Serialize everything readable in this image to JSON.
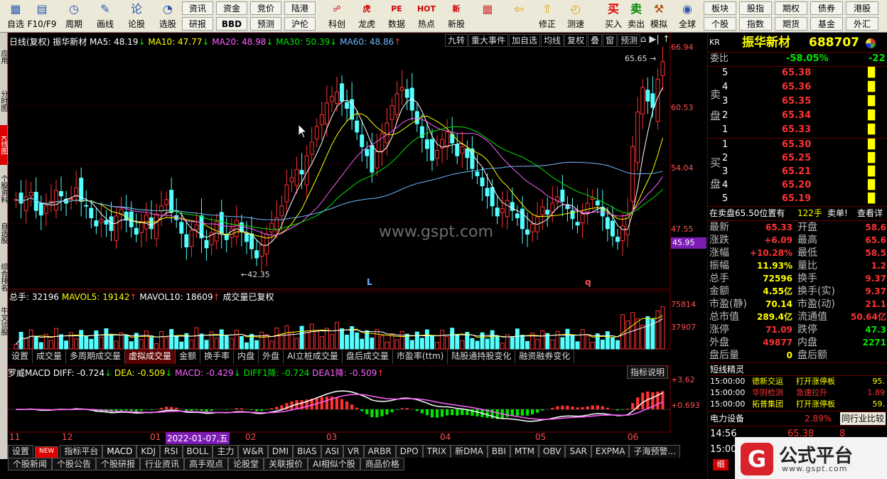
{
  "toolbar": {
    "items": [
      {
        "label": "自选",
        "icon": "▦"
      },
      {
        "label": "F10/F9",
        "icon": "▤"
      },
      {
        "label": "周期",
        "icon": "◷"
      },
      {
        "label": "画线",
        "icon": "✎"
      },
      {
        "label": "论股",
        "icon": "论"
      },
      {
        "label": "选股",
        "icon": "◔"
      }
    ],
    "boxes_top": [
      "资讯",
      "资金",
      "竞价",
      "陆港"
    ],
    "boxes_bottom": [
      "研报",
      "BBD",
      "预测",
      "沪伦"
    ],
    "items2": [
      {
        "label": "科创",
        "icon": "☍"
      },
      {
        "label": "龙虎",
        "icon": "虎"
      },
      {
        "label": "数据",
        "icon": "PE"
      },
      {
        "label": "热点",
        "icon": "HOT"
      },
      {
        "label": "新股",
        "icon": "新"
      }
    ],
    "items3": [
      {
        "label": "",
        "icon": "▦"
      },
      {
        "label": "",
        "icon": "⇦"
      },
      {
        "label": "修正",
        "icon": "⇧"
      },
      {
        "label": "测速",
        "icon": "◴"
      }
    ],
    "trade": [
      {
        "label": "买入",
        "icon": "买"
      },
      {
        "label": "卖出",
        "icon": "卖"
      },
      {
        "label": "模拟",
        "icon": "⚒"
      }
    ],
    "globe": {
      "label": "全球",
      "icon": "◉"
    },
    "right_top": [
      "板块",
      "股指",
      "期权",
      "债券",
      "全球"
    ],
    "right_top_txt": [
      "板块",
      "股指",
      "期权",
      "债券",
      "港股"
    ],
    "right_bottom": [
      "个股",
      "指数",
      "期货",
      "基金",
      "外汇"
    ]
  },
  "left_strip": [
    "应用",
    "分时图",
    "K线图",
    "个股资料",
    "自选股",
    "综合排名",
    "牛叉诊股"
  ],
  "chart_header": {
    "title": "日线(复权)",
    "name": "振华新材",
    "ma5": "MA5: 48.19",
    "ma10": "MA10: 47.77",
    "ma20": "MA20: 48.98",
    "ma30": "MA30: 50.39",
    "ma60": "MA60: 48.86",
    "buttons": [
      "九转",
      "重大事件",
      "加自选",
      "均线",
      "复权",
      "叠",
      "窗",
      "预测"
    ]
  },
  "price_axis": {
    "labels": [
      "66.94",
      "60.53",
      "54.04",
      "47.55"
    ],
    "current": "45.95"
  },
  "annotations": {
    "high": "65.65",
    "low": "42.35",
    "mark_l": "L",
    "mark_q": "q",
    "watermark": "www.gspt.com"
  },
  "volume_header": {
    "total": "总手: 32196",
    "mavol5": "MAVOL5: 19142",
    "mavol10": "MAVOL10: 18609",
    "note": "成交量已复权"
  },
  "volume_axis": [
    "75814",
    "37907"
  ],
  "volume_tabs": [
    "设置",
    "成交量",
    "多周期成交量",
    "虚拟成交量",
    "金额",
    "换手率",
    "内盘",
    "外盘",
    "AI立桩成交量",
    "盘后成交量",
    "市盈率(ttm)",
    "陆股通持股变化",
    "融资融券变化"
  ],
  "macd_header": {
    "name": "罗威MACD",
    "diff": "DIFF: -0.724",
    "dea": "DEA: -0.509",
    "macd": "MACD: -0.429",
    "diff1": "DIFF1降: -0.724",
    "dea1": "DEA1降: -0.509",
    "explain": "指标说明"
  },
  "macd_axis": [
    "+3.62",
    "+0.693"
  ],
  "date_axis": [
    "11",
    "12",
    "01",
    "2022-01-07,五",
    "02",
    "03",
    "04",
    "05",
    "06"
  ],
  "indicator_tabs": [
    "设置",
    "NEW",
    "指标平台",
    "MACD",
    "KDJ",
    "RSI",
    "BOLL",
    "主力",
    "W&R",
    "DMI",
    "BIAS",
    "ASI",
    "VR",
    "ARBR",
    "DPO",
    "TRIX",
    "新DMA",
    "BBI",
    "MTM",
    "OBV",
    "SAR",
    "EXPMA",
    "子海预警..."
  ],
  "news_tabs": [
    "个股新闻",
    "个股公告",
    "个股研报",
    "行业资讯",
    "高手观点",
    "论股堂",
    "关联报价",
    "AI相似个股",
    "商品价格"
  ],
  "right_panel": {
    "market": "KR",
    "stock_name": "振华新材",
    "code": "688707",
    "wei_label": "委比",
    "wei_val": "-58.05%",
    "wei_val2": "-22",
    "sell_label_top": "卖",
    "sell_label_bot": "盘",
    "buy_label_top": "买",
    "buy_label_bot": "盘",
    "sells": [
      {
        "n": "5",
        "p": "65.38"
      },
      {
        "n": "4",
        "p": "65.36"
      },
      {
        "n": "3",
        "p": "65.35"
      },
      {
        "n": "2",
        "p": "65.34"
      },
      {
        "n": "1",
        "p": "65.33"
      }
    ],
    "buys": [
      {
        "n": "1",
        "p": "65.30"
      },
      {
        "n": "2",
        "p": "65.25"
      },
      {
        "n": "3",
        "p": "65.21"
      },
      {
        "n": "4",
        "p": "65.20"
      },
      {
        "n": "5",
        "p": "65.19"
      }
    ],
    "order_line": {
      "text": "在卖盘65.50位置有",
      "qty": "122手",
      "tag": "卖单!",
      "link": "查看详"
    },
    "stats": [
      {
        "l": "最新",
        "v": "65.33",
        "l2": "开盘",
        "v2": "58.6"
      },
      {
        "l": "涨跌",
        "v": "+6.09",
        "l2": "最高",
        "v2": "65.6"
      },
      {
        "l": "涨幅",
        "v": "+10.28%",
        "l2": "最低",
        "v2": "58.5"
      },
      {
        "l": "振幅",
        "v": "11.93%",
        "l2": "量比",
        "v2": "1.2"
      },
      {
        "l": "总手",
        "v": "72596",
        "l2": "换手",
        "v2": "9.37"
      },
      {
        "l": "金额",
        "v": "4.55亿",
        "l2": "换手(实)",
        "v2": "9.37"
      },
      {
        "l": "市盈(静)",
        "v": "70.14",
        "l2": "市盈(动)",
        "v2": "21.1"
      },
      {
        "l": "总市值",
        "v": "289.4亿",
        "l2": "流通值",
        "v2": "50.64亿"
      },
      {
        "l": "涨停",
        "v": "71.09",
        "l2": "跌停",
        "v2": "47.3"
      },
      {
        "l": "外盘",
        "v": "49877",
        "l2": "内盘",
        "v2": "2271"
      },
      {
        "l": "盘后量",
        "v": "0",
        "l2": "盘后额",
        "v2": ""
      }
    ],
    "jingling_title": "短线精灵",
    "jingling": [
      {
        "t": "15:00:00",
        "s": "德新交运",
        "e": "打开涨停板",
        "v": "95."
      },
      {
        "t": "15:00:00",
        "s": "华则检测",
        "e": "急速拉升",
        "v": "1.89"
      },
      {
        "t": "15:00:00",
        "s": "拓普集团",
        "e": "打开涨停板",
        "v": "59."
      }
    ],
    "sector": {
      "name": "电力设备",
      "pct": "2.89%",
      "btn": "同行业比较"
    },
    "tick": {
      "t": "14:56",
      "p": "65.38",
      "q": "8"
    },
    "tick2": {
      "t": "15:00"
    },
    "brand": {
      "cn": "公式平台",
      "url": "www.gspt.com",
      "btn": "细"
    }
  }
}
